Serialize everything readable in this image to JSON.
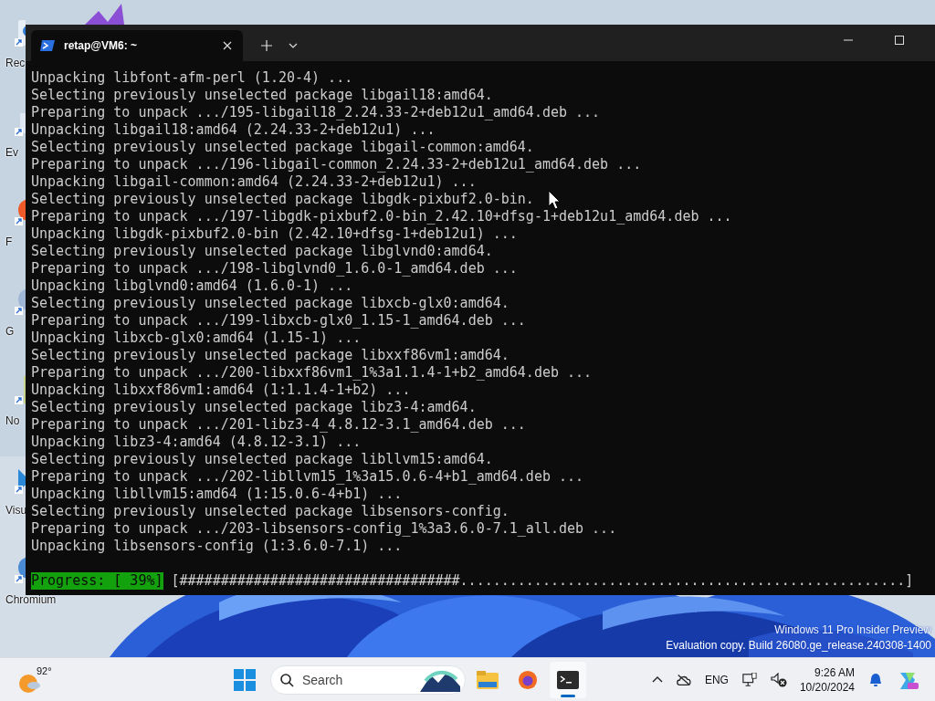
{
  "desktop": {
    "icons": [
      {
        "label": "Rec"
      },
      {
        "label": "Ev"
      },
      {
        "label": "F"
      },
      {
        "label": "G"
      },
      {
        "label": "No"
      },
      {
        "label": "Visu"
      },
      {
        "label": "Chromium"
      }
    ],
    "os_notice": [
      "Windows 11 Pro Insider Preview",
      "Evaluation copy. Build 26080.ge_release.240308-1400"
    ]
  },
  "terminal": {
    "tabs": [
      {
        "title": "retap@VM6: ~",
        "selected": true
      }
    ],
    "lines": [
      "Unpacking libfont-afm-perl (1.20-4) ...",
      "Selecting previously unselected package libgail18:amd64.",
      "Preparing to unpack .../195-libgail18_2.24.33-2+deb12u1_amd64.deb ...",
      "Unpacking libgail18:amd64 (2.24.33-2+deb12u1) ...",
      "Selecting previously unselected package libgail-common:amd64.",
      "Preparing to unpack .../196-libgail-common_2.24.33-2+deb12u1_amd64.deb ...",
      "Unpacking libgail-common:amd64 (2.24.33-2+deb12u1) ...",
      "Selecting previously unselected package libgdk-pixbuf2.0-bin.",
      "Preparing to unpack .../197-libgdk-pixbuf2.0-bin_2.42.10+dfsg-1+deb12u1_amd64.deb ...",
      "Unpacking libgdk-pixbuf2.0-bin (2.42.10+dfsg-1+deb12u1) ...",
      "Selecting previously unselected package libglvnd0:amd64.",
      "Preparing to unpack .../198-libglvnd0_1.6.0-1_amd64.deb ...",
      "Unpacking libglvnd0:amd64 (1.6.0-1) ...",
      "Selecting previously unselected package libxcb-glx0:amd64.",
      "Preparing to unpack .../199-libxcb-glx0_1.15-1_amd64.deb ...",
      "Unpacking libxcb-glx0:amd64 (1.15-1) ...",
      "Selecting previously unselected package libxxf86vm1:amd64.",
      "Preparing to unpack .../200-libxxf86vm1_1%3a1.1.4-1+b2_amd64.deb ...",
      "Unpacking libxxf86vm1:amd64 (1:1.1.4-1+b2) ...",
      "Selecting previously unselected package libz3-4:amd64.",
      "Preparing to unpack .../201-libz3-4_4.8.12-3.1_amd64.deb ...",
      "Unpacking libz3-4:amd64 (4.8.12-3.1) ...",
      "Selecting previously unselected package libllvm15:amd64.",
      "Preparing to unpack .../202-libllvm15_1%3a15.0.6-4+b1_amd64.deb ...",
      "Unpacking libllvm15:amd64 (1:15.0.6-4+b1) ...",
      "Selecting previously unselected package libsensors-config.",
      "Preparing to unpack .../203-libsensors-config_1%3a3.6.0-7.1_all.deb ...",
      "Unpacking libsensors-config (1:3.6.0-7.1) ..."
    ],
    "progress": {
      "label": "Progress: [ 39%]",
      "bar": "[##################################......................................................]"
    }
  },
  "taskbar": {
    "weather": {
      "temperature": "92°"
    },
    "search": {
      "placeholder": "Search"
    },
    "apps": [
      {
        "kind": "explorer",
        "active": false
      },
      {
        "kind": "firefox",
        "active": false
      },
      {
        "kind": "terminal",
        "active": true
      }
    ],
    "tray": {
      "language": "ENG",
      "time": "9:26 AM",
      "date": "10/20/2024"
    }
  }
}
